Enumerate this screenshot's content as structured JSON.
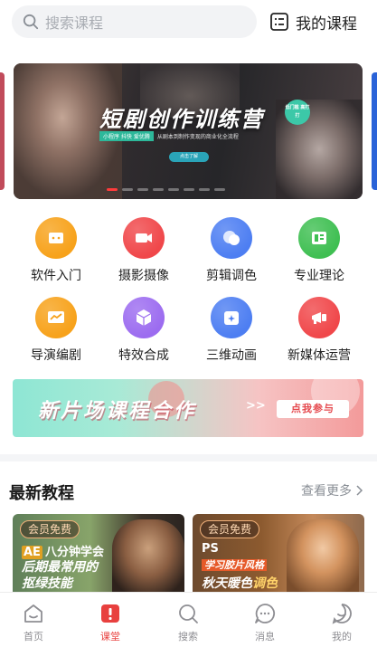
{
  "search": {
    "placeholder": "搜索课程"
  },
  "header": {
    "my_courses_label": "我的课程"
  },
  "banner": {
    "title": "短剧创作训练营",
    "tags": "小程序 抖快 爱优腾",
    "desc": "从剧本到制作变现的商业化全流程",
    "cta": "点击了解",
    "badge": "低门槛 高打打",
    "total_slides": 8,
    "active_slide": 1
  },
  "categories": [
    {
      "label": "软件入门",
      "icon": "software-icon",
      "color": "#f7a21b"
    },
    {
      "label": "摄影摄像",
      "icon": "camera-icon",
      "color": "#f0474a"
    },
    {
      "label": "剪辑调色",
      "icon": "edit-color-icon",
      "color": "#4d7ef2"
    },
    {
      "label": "专业理论",
      "icon": "theory-icon",
      "color": "#3fbf52"
    },
    {
      "label": "导演编剧",
      "icon": "director-icon",
      "color": "#f7a21b"
    },
    {
      "label": "特效合成",
      "icon": "vfx-icon",
      "color": "#9c6cf0"
    },
    {
      "label": "三维动画",
      "icon": "3d-icon",
      "color": "#4d7ef2"
    },
    {
      "label": "新媒体运营",
      "icon": "media-icon",
      "color": "#f0474a"
    }
  ],
  "promo": {
    "title": "新片场课程合作",
    "arrows": ">>",
    "button": "点我参与"
  },
  "latest": {
    "title": "最新教程",
    "more": "查看更多",
    "cards": [
      {
        "badge": "会员免费",
        "tag": "AE",
        "line1": "八分钟学会",
        "line2": "后期最常用的",
        "line3": "抠绿技能"
      },
      {
        "badge": "会员免费",
        "tag": "PS",
        "line1": "学习胶片风格",
        "line2": "秋天暖色",
        "line3": "调色"
      }
    ]
  },
  "tabbar": {
    "active": "课堂",
    "items": [
      {
        "label": "首页",
        "icon": "home-icon"
      },
      {
        "label": "课堂",
        "icon": "classroom-icon"
      },
      {
        "label": "搜索",
        "icon": "search-icon"
      },
      {
        "label": "消息",
        "icon": "message-icon"
      },
      {
        "label": "我的",
        "icon": "profile-icon"
      }
    ]
  },
  "colors": {
    "accent": "#e8403e",
    "promo_button_text": "#e5484d"
  }
}
